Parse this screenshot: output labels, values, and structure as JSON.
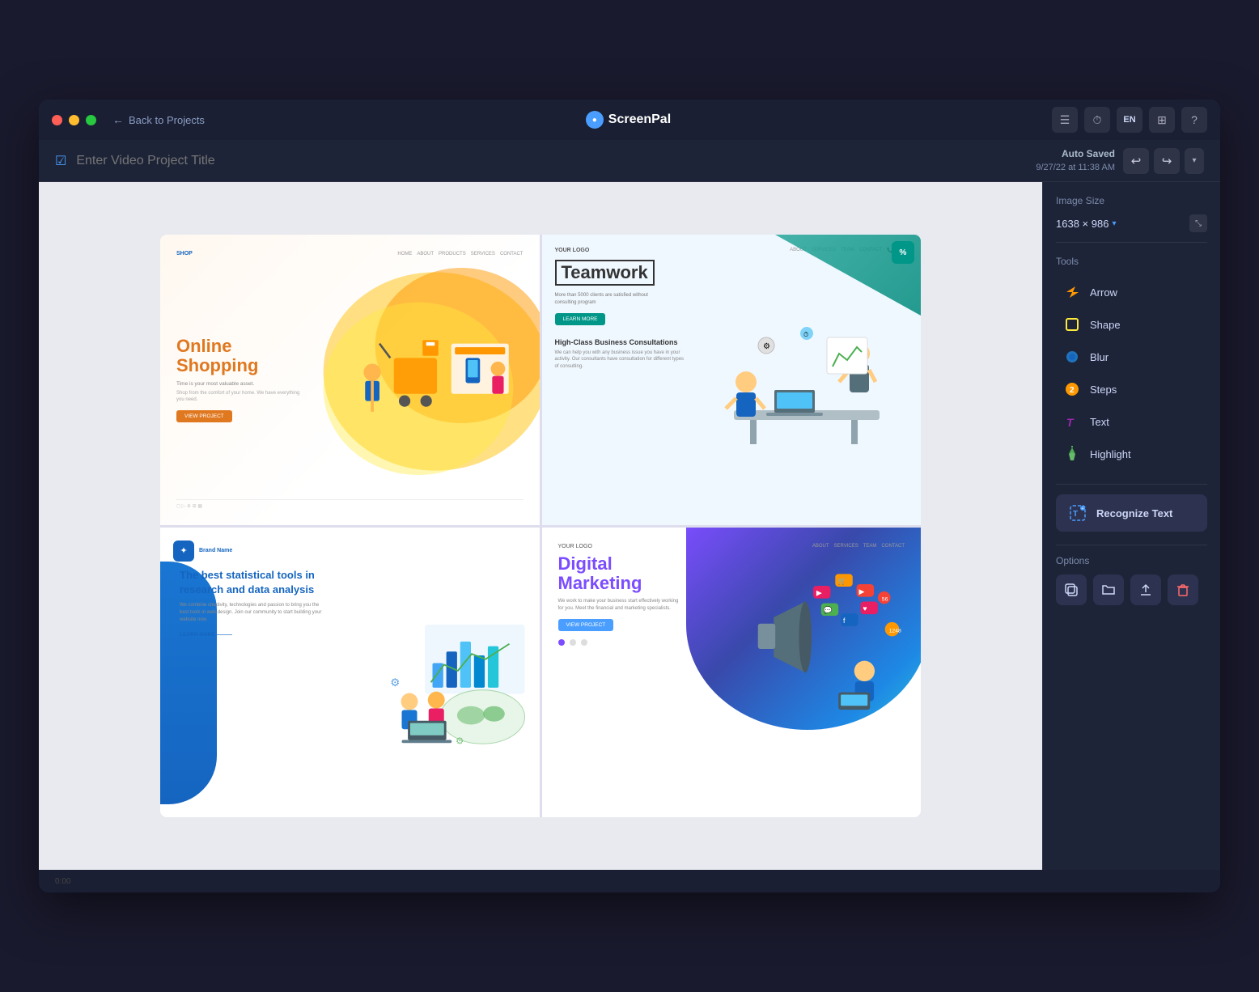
{
  "window": {
    "title": "ScreenPal",
    "logo": "ScreenPal",
    "back_label": "Back to Projects"
  },
  "titlebar": {
    "icons": {
      "list": "☰",
      "clock": "⏱",
      "lang": "EN",
      "layers": "⊞",
      "help": "?"
    }
  },
  "project": {
    "title_placeholder": "Enter Video Project Title",
    "auto_saved_label": "Auto Saved",
    "auto_saved_time": "9/27/22 at 11:38 AM",
    "undo_label": "↩",
    "redo_label": "↪"
  },
  "sidebar": {
    "image_size_label": "Image Size",
    "image_size_value": "1638 × 986",
    "tools_label": "Tools",
    "tools": [
      {
        "id": "arrow",
        "label": "Arrow",
        "icon": "🔶"
      },
      {
        "id": "shape",
        "label": "Shape",
        "icon": "🟡"
      },
      {
        "id": "blur",
        "label": "Blur",
        "icon": "🔵"
      },
      {
        "id": "steps",
        "label": "Steps",
        "icon": "🟠"
      },
      {
        "id": "text",
        "label": "Text",
        "icon": "🅣"
      },
      {
        "id": "highlight",
        "label": "Highlight",
        "icon": "✳"
      }
    ],
    "recognize_label": "Recognize Text",
    "options_label": "Options",
    "options": [
      {
        "id": "copy",
        "icon": "⎘"
      },
      {
        "id": "folder",
        "icon": "📁"
      },
      {
        "id": "upload",
        "icon": "⬆"
      },
      {
        "id": "delete",
        "icon": "🗑"
      }
    ]
  },
  "slides": [
    {
      "id": "slide1",
      "type": "online-shopping",
      "title1": "Online",
      "title2": "Shopping",
      "description": "Time is your most valuable asset."
    },
    {
      "id": "slide2",
      "type": "teamwork",
      "title": "Teamwork",
      "subtitle": "High-Class Business Consultations"
    },
    {
      "id": "slide3",
      "type": "statistical",
      "title": "The best statistical tools in research and data analysis"
    },
    {
      "id": "slide4",
      "type": "digital-marketing",
      "title1": "Digital",
      "title2": "Marketing"
    }
  ]
}
